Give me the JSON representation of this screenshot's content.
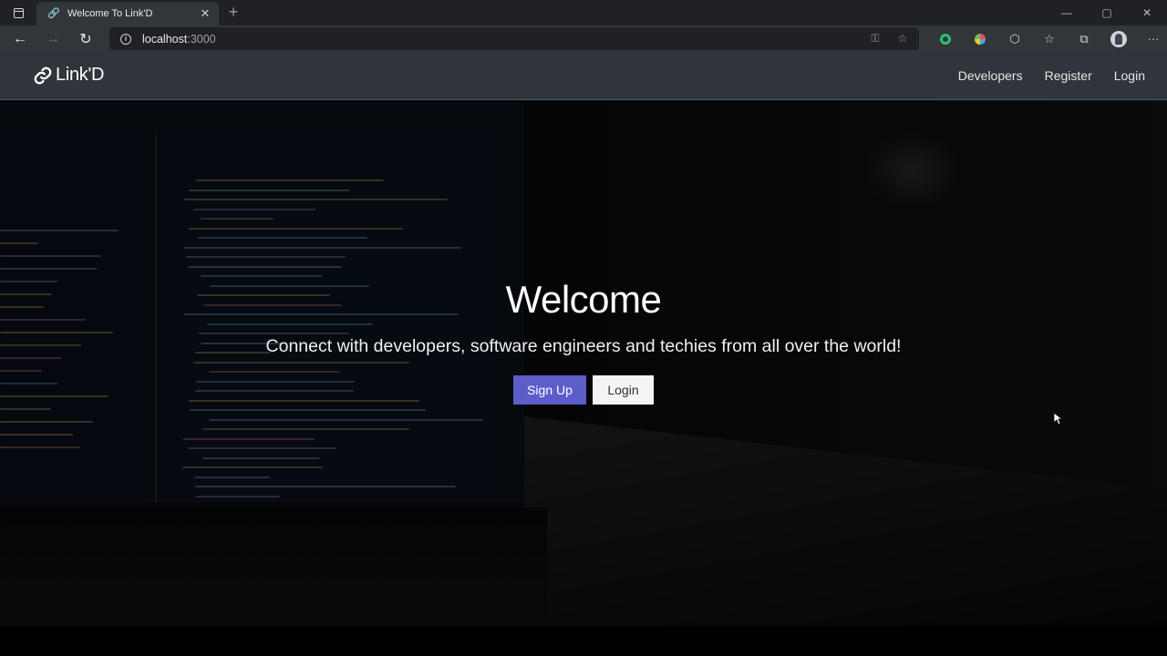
{
  "browser": {
    "tab_title": "Welcome To Link'D",
    "url_host": "localhost",
    "url_port": ":3000"
  },
  "navbar": {
    "brand": "Link'D",
    "links": [
      "Developers",
      "Register",
      "Login"
    ]
  },
  "landing": {
    "heading": "Welcome",
    "lead": "Connect with developers, software engineers and techies from all over the world!",
    "signup_label": "Sign Up",
    "login_label": "Login"
  },
  "colors": {
    "primary": "#5c5dc9",
    "navbar": "#343a40"
  }
}
